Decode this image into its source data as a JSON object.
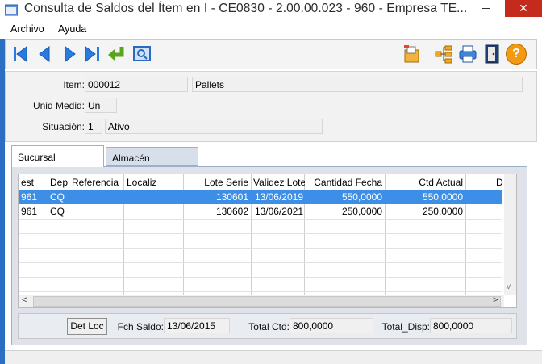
{
  "window": {
    "title": "Consulta de Saldos del Ítem en I - CE0830 - 2.00.00.023 - 960 - Empresa TE...",
    "close_glyph": "✕"
  },
  "menu": {
    "archivo": "Archivo",
    "ayuda": "Ayuda"
  },
  "toolbar": {
    "icons": [
      "first-icon",
      "previous-icon",
      "next-icon",
      "last-icon",
      "enter-icon",
      "search-icon",
      "report-icon",
      "tree-icon",
      "print-icon",
      "exit-icon",
      "help-icon"
    ],
    "help_glyph": "?"
  },
  "item": {
    "item_label": "Item:",
    "item_code": "000012",
    "item_desc": "Pallets",
    "unit_label": "Unid Medid:",
    "unit_value": "Un",
    "status_label": "Situación:",
    "status_code": "1",
    "status_desc": "Ativo"
  },
  "tabs": {
    "sucursal": "Sucursal",
    "almacen": "Almacén"
  },
  "grid": {
    "columns": [
      "est",
      "Dep",
      "Referencia",
      "Localiz",
      "Lote Serie",
      "Validez Lote",
      "Cantidad Fecha",
      "Ctd Actual",
      "D"
    ],
    "rows": [
      {
        "est": "961",
        "dep": "CQ",
        "referencia": "",
        "localiz": "",
        "lote": "130601",
        "validez": "13/06/2019",
        "cantidad": "550,0000",
        "actual": "550,0000"
      },
      {
        "est": "961",
        "dep": "CQ",
        "referencia": "",
        "localiz": "",
        "lote": "130602",
        "validez": "13/06/2021",
        "cantidad": "250,0000",
        "actual": "250,0000"
      }
    ],
    "scroll_left": "<",
    "scroll_right": ">",
    "scroll_down": "v"
  },
  "footer": {
    "det_loc": "Det Loc",
    "fch_saldo_label": "Fch Saldo:",
    "fch_saldo_value": "13/06/2015",
    "total_ctd_label": "Total Ctd:",
    "total_ctd_value": "800,0000",
    "total_disp_label": "Total_Disp:",
    "total_disp_value": "800,0000"
  }
}
